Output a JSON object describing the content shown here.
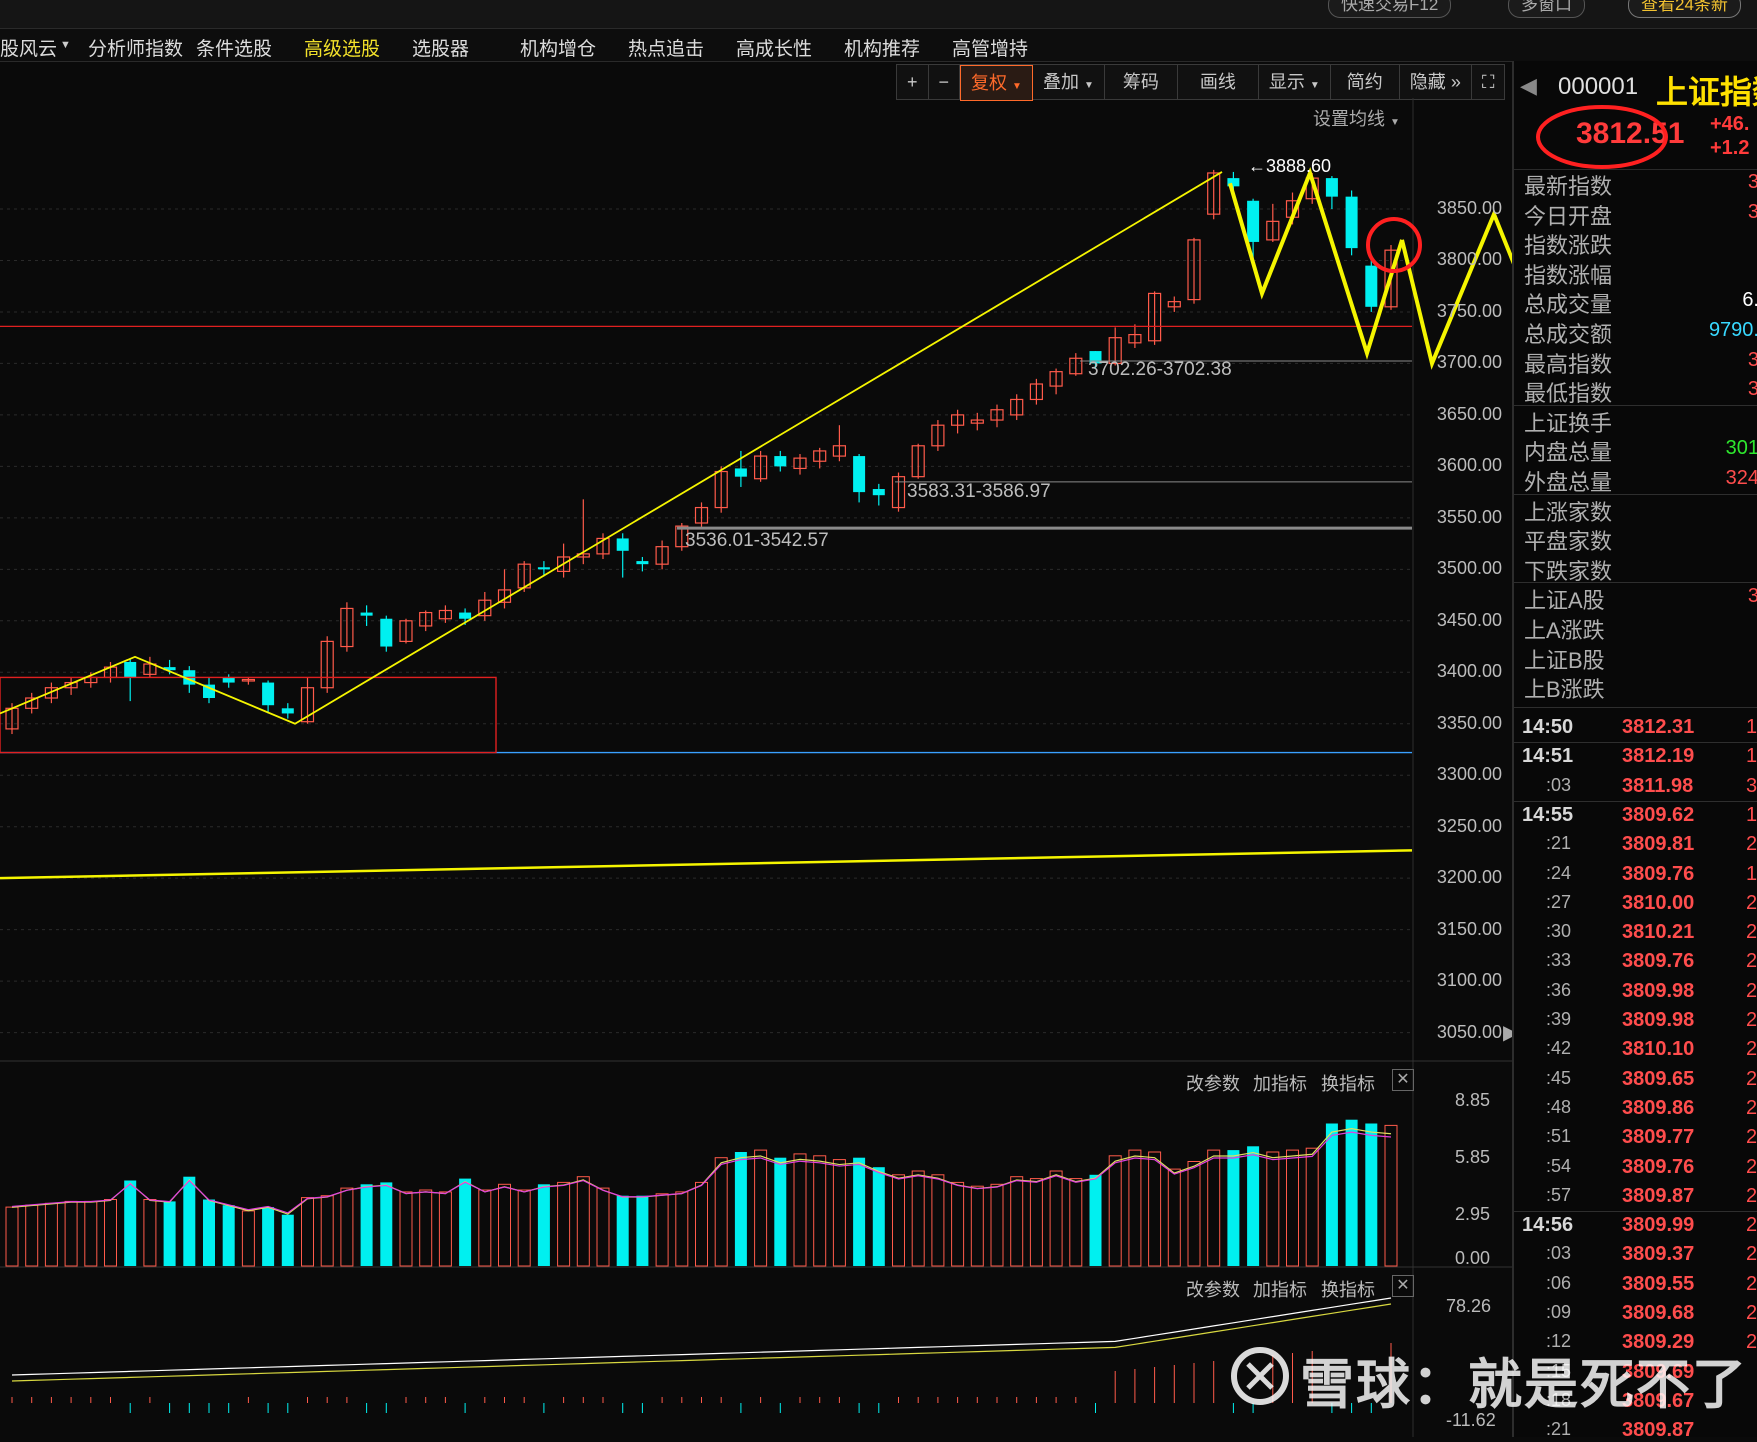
{
  "topbar": {
    "quick_trade": "快速交易F12",
    "multi_window": "多窗口",
    "news": "查看24条新"
  },
  "menu": [
    "股风云",
    "分析师指数",
    "条件选股",
    "高级选股",
    "选股器",
    "机构增仓",
    "热点追击",
    "高成长性",
    "机构推荐",
    "高管增持"
  ],
  "toolbar": {
    "plus": "+",
    "minus": "−",
    "fuquan": "复权",
    "diejia": "叠加",
    "chouma": "筹码",
    "huaxian": "画线",
    "xianshi": "显示",
    "jianyue": "简约",
    "yincang": "隐藏"
  },
  "chart_settings": "设置均线",
  "annotations": {
    "high": "3888.60",
    "gap1": "3702.26-3702.38",
    "gap2": "3583.31-3586.97",
    "gap3": "3536.01-3542.57"
  },
  "yaxis": [
    "3850.00",
    "3800.00",
    "3750.00",
    "3700.00",
    "3650.00",
    "3600.00",
    "3550.00",
    "3500.00",
    "3450.00",
    "3400.00",
    "3350.00",
    "3300.00",
    "3250.00",
    "3200.00",
    "3150.00",
    "3100.00",
    "3050.00"
  ],
  "vol_panel": {
    "labels": [
      "改参数",
      "加指标",
      "换指标"
    ],
    "axis": [
      "8.85",
      "5.85",
      "2.95",
      "0.00"
    ]
  },
  "osc_panel": {
    "labels": [
      "改参数",
      "加指标",
      "换指标"
    ],
    "axis": [
      "78.26",
      "-11.62"
    ]
  },
  "quote": {
    "code": "000001",
    "name": "上证指数",
    "price": "3812.51",
    "change": "+46.",
    "change_pct": "+1.2"
  },
  "fields": [
    {
      "label": "最新指数",
      "value": "3",
      "color": "#ff4d4d"
    },
    {
      "label": "今日开盘",
      "value": "3",
      "color": "#ff4d4d"
    },
    {
      "label": "指数涨跌",
      "value": "",
      "color": "#ff4d4d"
    },
    {
      "label": "指数涨幅",
      "value": "",
      "color": "#ff4d4d"
    },
    {
      "label": "总成交量",
      "value": "6.",
      "color": "#ffffff"
    },
    {
      "label": "总成交额",
      "value": "9790.",
      "color": "#38d9ff"
    },
    {
      "label": "最高指数",
      "value": "3",
      "color": "#ff4d4d"
    },
    {
      "label": "最低指数",
      "value": "3",
      "color": "#ff4d4d"
    },
    {
      "label": "上证换手",
      "value": "",
      "color": "#ffffff"
    },
    {
      "label": "内盘总量",
      "value": "301",
      "color": "#2ee82e"
    },
    {
      "label": "外盘总量",
      "value": "324",
      "color": "#ff4d4d"
    },
    {
      "label": "上涨家数",
      "value": "",
      "color": "#ff4d4d"
    },
    {
      "label": "平盘家数",
      "value": "",
      "color": "#ffffff"
    },
    {
      "label": "下跌家数",
      "value": "",
      "color": "#2ee82e"
    },
    {
      "label": "上证A股",
      "value": "3",
      "color": "#ff4d4d"
    },
    {
      "label": "上A涨跌",
      "value": "",
      "color": "#ff4d4d"
    },
    {
      "label": "上证B股",
      "value": "",
      "color": "#ff4d4d"
    },
    {
      "label": "上B涨跌",
      "value": "",
      "color": "#ff4d4d"
    }
  ],
  "ticks": [
    {
      "t": "14:50",
      "p": "3812.31",
      "v": "1",
      "major": true
    },
    {
      "t": "14:51",
      "p": "3812.19",
      "v": "1",
      "major": true
    },
    {
      "t": ":03",
      "p": "3811.98",
      "v": "3",
      "major": false
    },
    {
      "t": "14:55",
      "p": "3809.62",
      "v": "1",
      "major": true
    },
    {
      "t": ":21",
      "p": "3809.81",
      "v": "2",
      "major": false
    },
    {
      "t": ":24",
      "p": "3809.76",
      "v": "1",
      "major": false
    },
    {
      "t": ":27",
      "p": "3810.00",
      "v": "2",
      "major": false
    },
    {
      "t": ":30",
      "p": "3810.21",
      "v": "2",
      "major": false
    },
    {
      "t": ":33",
      "p": "3809.76",
      "v": "2",
      "major": false
    },
    {
      "t": ":36",
      "p": "3809.98",
      "v": "2",
      "major": false
    },
    {
      "t": ":39",
      "p": "3809.98",
      "v": "2",
      "major": false
    },
    {
      "t": ":42",
      "p": "3810.10",
      "v": "2",
      "major": false
    },
    {
      "t": ":45",
      "p": "3809.65",
      "v": "2",
      "major": false
    },
    {
      "t": ":48",
      "p": "3809.86",
      "v": "2",
      "major": false
    },
    {
      "t": ":51",
      "p": "3809.77",
      "v": "2",
      "major": false
    },
    {
      "t": ":54",
      "p": "3809.76",
      "v": "2",
      "major": false
    },
    {
      "t": ":57",
      "p": "3809.87",
      "v": "2",
      "major": false
    },
    {
      "t": "14:56",
      "p": "3809.99",
      "v": "2",
      "major": true
    },
    {
      "t": ":03",
      "p": "3809.37",
      "v": "2",
      "major": false
    },
    {
      "t": ":06",
      "p": "3809.55",
      "v": "2",
      "major": false
    },
    {
      "t": ":09",
      "p": "3809.68",
      "v": "2",
      "major": false
    },
    {
      "t": ":12",
      "p": "3809.29",
      "v": "2",
      "major": false
    },
    {
      "t": ":15",
      "p": "3809.69",
      "v": "",
      "major": false
    },
    {
      "t": ":18",
      "p": "3809.67",
      "v": "",
      "major": false
    },
    {
      "t": ":21",
      "p": "3809.87",
      "v": "",
      "major": false
    }
  ],
  "watermark": "雪球：就是死不了",
  "colors": {
    "up": "#ff5a4a",
    "down": "#00f0f0",
    "trend": "#f5f500",
    "bg": "#0a0a0a"
  }
}
